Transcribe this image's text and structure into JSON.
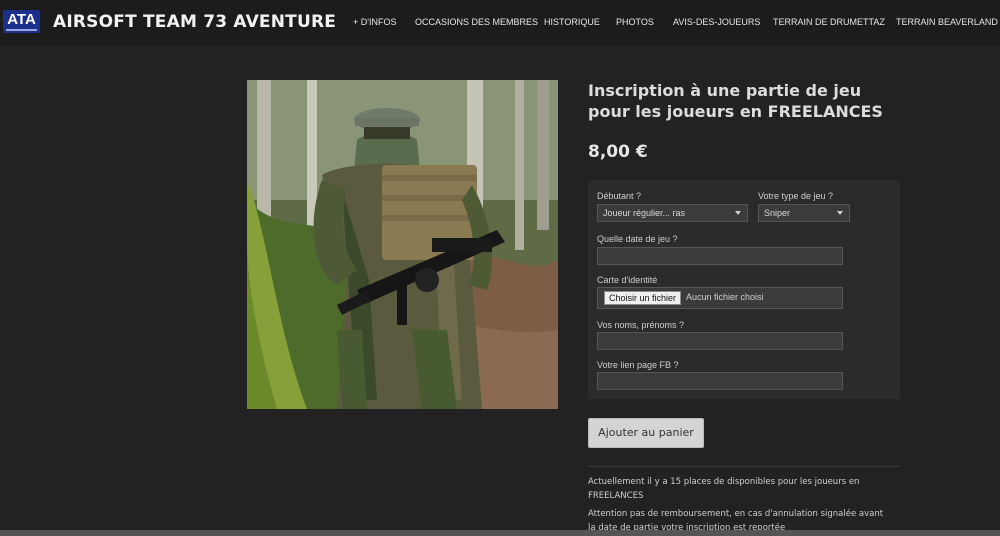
{
  "header": {
    "logo_text": "ATA",
    "site_title": "AIRSOFT TEAM 73 AVENTURE",
    "nav": [
      "+ D'INFOS",
      "OCCASIONS DES MEMBRES",
      "HISTORIQUE",
      "PHOTOS",
      "AVIS-DES-JOUEURS",
      "TERRAIN DE DRUMETTAZ",
      "TERRAIN BEAVERLAND"
    ]
  },
  "product": {
    "title": "Inscription à une partie de jeu pour les joueurs en FREELANCES",
    "price": "8,00 €"
  },
  "form": {
    "level_label": "Débutant ?",
    "level_value": "Joueur régulier... ras",
    "type_label": "Votre type de jeu ?",
    "type_value": "Sniper",
    "date_label": "Quelle date de jeu ?",
    "id_label": "Carte d'identité",
    "file_button": "Choisir un fichier",
    "file_status": "Aucun fichier choisi",
    "names_label": "Vos noms, prénoms ?",
    "fb_label": "Votre lien page FB ?"
  },
  "cart": {
    "add_label": "Ajouter au panier"
  },
  "info": {
    "places": "Actuellement il y a 15 places de disponibles pour les joueurs en FREELANCES",
    "refund": "Attention pas de remboursement, en cas d'annulation signalée avant la date de partie votre inscription est reportée"
  },
  "colors": {
    "background": "#222222",
    "topbar": "#1c1c1c",
    "logo": "#1c2f8a"
  }
}
